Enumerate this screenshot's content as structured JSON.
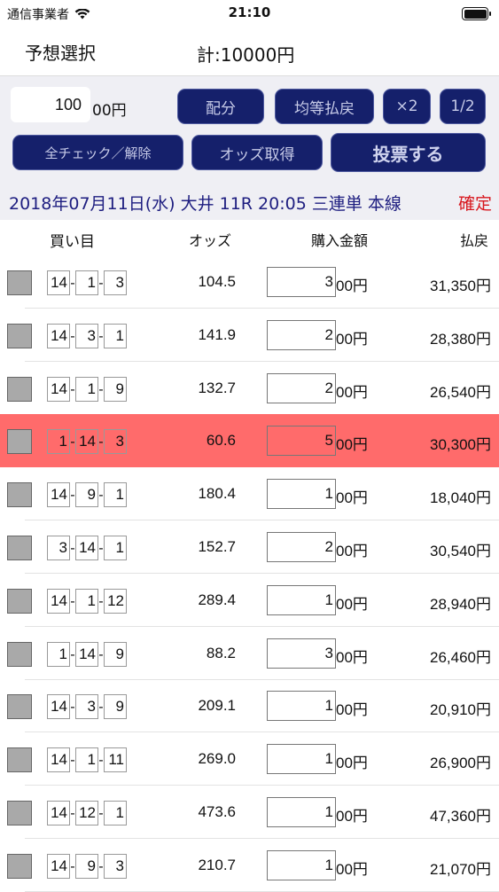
{
  "status": {
    "carrier": "通信事業者",
    "time": "21:10"
  },
  "header": {
    "title": "予想選択",
    "total": "計:10000円"
  },
  "controls": {
    "unit_value": "100",
    "unit_suffix": "00円",
    "buttons": {
      "distribute": "配分",
      "equal_payout": "均等払戻",
      "double": "×2",
      "half": "1/2",
      "check_all": "全チェック／解除",
      "get_odds": "オッズ取得",
      "vote": "投票する"
    }
  },
  "race": {
    "info": "2018年07月11日(水) 大井 11R 20:05 三連単 本線",
    "status": "確定"
  },
  "columns": {
    "combo": "買い目",
    "odds": "オッズ",
    "amount": "購入金額",
    "payout": "払戻"
  },
  "rows": [
    {
      "n1": "14",
      "n2": "1",
      "n3": "3",
      "odds": "104.5",
      "bet": "3",
      "bet_suffix": "00円",
      "payout": "31,350円",
      "highlight": false
    },
    {
      "n1": "14",
      "n2": "3",
      "n3": "1",
      "odds": "141.9",
      "bet": "2",
      "bet_suffix": "00円",
      "payout": "28,380円",
      "highlight": false
    },
    {
      "n1": "14",
      "n2": "1",
      "n3": "9",
      "odds": "132.7",
      "bet": "2",
      "bet_suffix": "00円",
      "payout": "26,540円",
      "highlight": false
    },
    {
      "n1": "1",
      "n2": "14",
      "n3": "3",
      "odds": "60.6",
      "bet": "5",
      "bet_suffix": "00円",
      "payout": "30,300円",
      "highlight": true
    },
    {
      "n1": "14",
      "n2": "9",
      "n3": "1",
      "odds": "180.4",
      "bet": "1",
      "bet_suffix": "00円",
      "payout": "18,040円",
      "highlight": false
    },
    {
      "n1": "3",
      "n2": "14",
      "n3": "1",
      "odds": "152.7",
      "bet": "2",
      "bet_suffix": "00円",
      "payout": "30,540円",
      "highlight": false
    },
    {
      "n1": "14",
      "n2": "1",
      "n3": "12",
      "odds": "289.4",
      "bet": "1",
      "bet_suffix": "00円",
      "payout": "28,940円",
      "highlight": false
    },
    {
      "n1": "1",
      "n2": "14",
      "n3": "9",
      "odds": "88.2",
      "bet": "3",
      "bet_suffix": "00円",
      "payout": "26,460円",
      "highlight": false
    },
    {
      "n1": "14",
      "n2": "3",
      "n3": "9",
      "odds": "209.1",
      "bet": "1",
      "bet_suffix": "00円",
      "payout": "20,910円",
      "highlight": false
    },
    {
      "n1": "14",
      "n2": "1",
      "n3": "11",
      "odds": "269.0",
      "bet": "1",
      "bet_suffix": "00円",
      "payout": "26,900円",
      "highlight": false
    },
    {
      "n1": "14",
      "n2": "12",
      "n3": "1",
      "odds": "473.6",
      "bet": "1",
      "bet_suffix": "00円",
      "payout": "47,360円",
      "highlight": false
    },
    {
      "n1": "14",
      "n2": "9",
      "n3": "3",
      "odds": "210.7",
      "bet": "1",
      "bet_suffix": "00円",
      "payout": "21,070円",
      "highlight": false
    }
  ]
}
